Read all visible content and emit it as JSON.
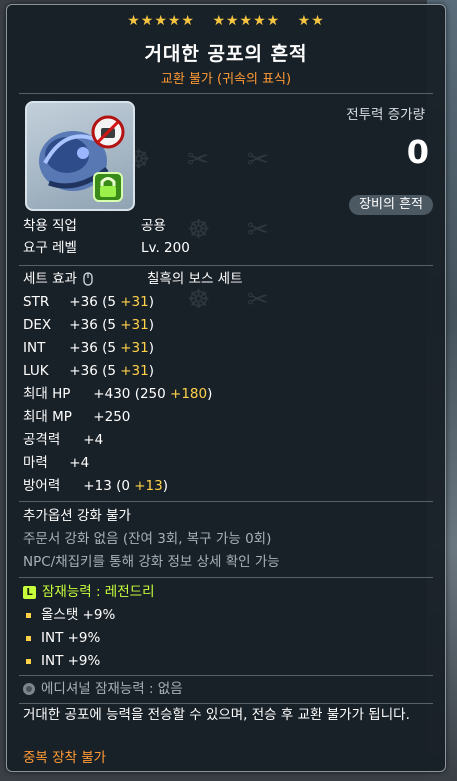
{
  "header": {
    "stars": [
      "★★★★★",
      "★★★★★",
      "★★"
    ],
    "title": "거대한 공포의 흔적",
    "subtitle": "교환 불가 (귀속의 표식)"
  },
  "power": {
    "label": "전투력 증가량",
    "value": "0",
    "trace_button": "장비의 흔적"
  },
  "requirements": {
    "job_label": "착용 직업",
    "job_value": "공용",
    "level_label": "요구 레벨",
    "level_value": "Lv. 200"
  },
  "set": {
    "label": "세트 효과",
    "value": "칠흑의 보스 세트"
  },
  "stats": [
    {
      "name": "STR",
      "total": "+36",
      "base": "(5",
      "bonus": "+31",
      "close": ")"
    },
    {
      "name": "DEX",
      "total": "+36",
      "base": "(5",
      "bonus": "+31",
      "close": ")"
    },
    {
      "name": "INT",
      "total": "+36",
      "base": "(5",
      "bonus": "+31",
      "close": ")"
    },
    {
      "name": "LUK",
      "total": "+36",
      "base": "(5",
      "bonus": "+31",
      "close": ")"
    }
  ],
  "hp": {
    "name": "최대 HP",
    "total": "+430",
    "base": "(250",
    "bonus": "+180",
    "close": ")"
  },
  "mp": {
    "name": "최대 MP",
    "total": "+250"
  },
  "attack": {
    "name": "공격력",
    "total": "+4"
  },
  "magic": {
    "name": "마력",
    "total": "+4"
  },
  "defense": {
    "name": "방어력",
    "total": "+13",
    "base": "(0",
    "bonus": "+13",
    "close": ")"
  },
  "upgrade": {
    "title": "추가옵션 강화 불가",
    "line1": "주문서 강화 없음 (잔여 3회, 복구 가능 0회)",
    "line2": "NPC/채집키를 통해 강화 정보 상세 확인 가능"
  },
  "potential": {
    "badge": "L",
    "title": "잠재능력 : 레전드리",
    "lines": [
      "올스탯 +9%",
      "INT +9%",
      "INT +9%"
    ],
    "additional": "에디셔널 잠재능력 : 없음"
  },
  "description": {
    "text_a": "거대한 공포에 능력을 전승할 수 있으며, 전승 후 ",
    "text_b": "교환 불가",
    "text_c": "가 됩니다.",
    "warning": "중복 장착 불가"
  },
  "colors": {
    "star": "#f5c542",
    "orange": "#ff9a33",
    "plus": "#ffd24a",
    "legendary": "#c8ff3c",
    "panel": "#171f26"
  },
  "icons": [
    "no-trade-icon",
    "lock-icon",
    "mouse-icon",
    "legendary-badge-icon",
    "additional-potential-icon"
  ]
}
